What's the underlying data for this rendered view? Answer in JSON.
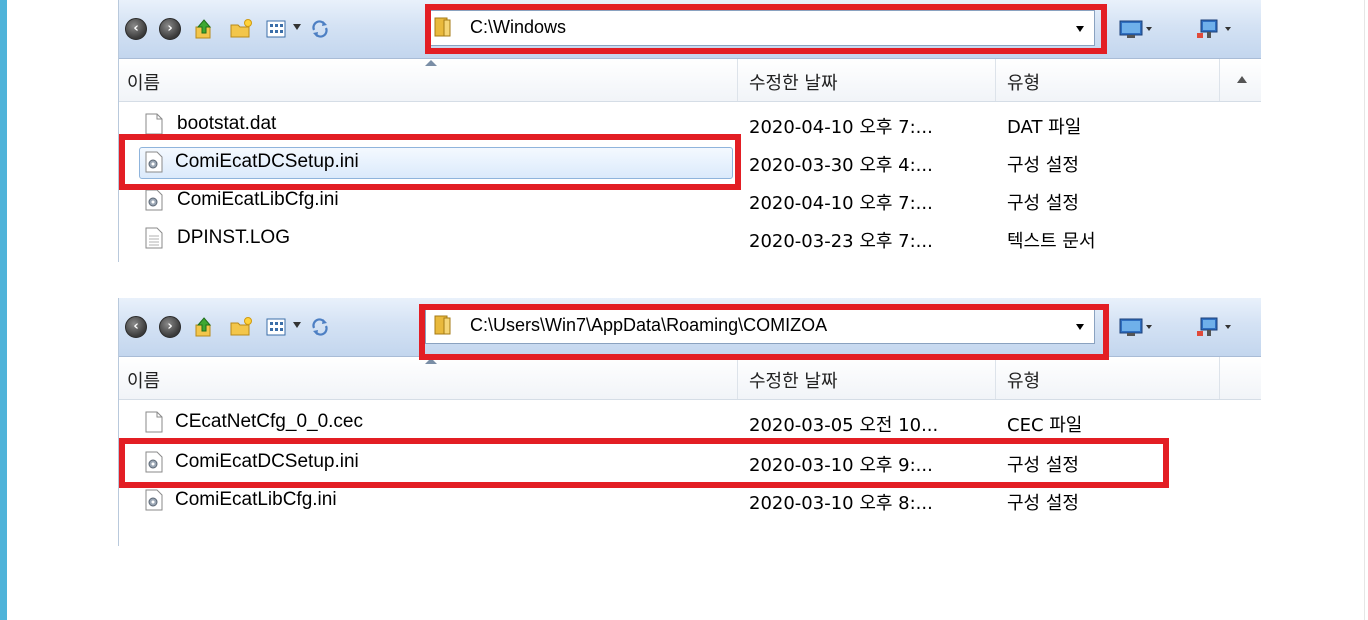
{
  "explorer1": {
    "address": "C:\\Windows",
    "columns": {
      "name": "이름",
      "date": "수정한 날짜",
      "type": "유형"
    },
    "files": [
      {
        "name": "bootstat.dat",
        "date": "2020-04-10 오후 7:...",
        "type": "DAT 파일",
        "icon": "blank-file-icon"
      },
      {
        "name": "ComiEcatDCSetup.ini",
        "date": "2020-03-30 오후 4:...",
        "type": "구성 설정",
        "icon": "config-file-icon"
      },
      {
        "name": "ComiEcatLibCfg.ini",
        "date": "2020-04-10 오후 7:...",
        "type": "구성 설정",
        "icon": "config-file-icon"
      },
      {
        "name": "DPINST.LOG",
        "date": "2020-03-23 오후 7:...",
        "type": "텍스트 문서",
        "icon": "text-file-icon"
      }
    ]
  },
  "explorer2": {
    "address": "C:\\Users\\Win7\\AppData\\Roaming\\COMIZOA",
    "columns": {
      "name": "이름",
      "date": "수정한 날짜",
      "type": "유형"
    },
    "files": [
      {
        "name": "CEcatNetCfg_0_0.cec",
        "date": "2020-03-05 오전 10...",
        "type": "CEC 파일",
        "icon": "blank-file-icon"
      },
      {
        "name": "ComiEcatDCSetup.ini",
        "date": "2020-03-10 오후 9:...",
        "type": "구성 설정",
        "icon": "config-file-icon"
      },
      {
        "name": "ComiEcatLibCfg.ini",
        "date": "2020-03-10 오후 8:...",
        "type": "구성 설정",
        "icon": "config-file-icon"
      }
    ]
  },
  "colors": {
    "highlight": "#e31e24",
    "accent": "#4fb3d9"
  }
}
